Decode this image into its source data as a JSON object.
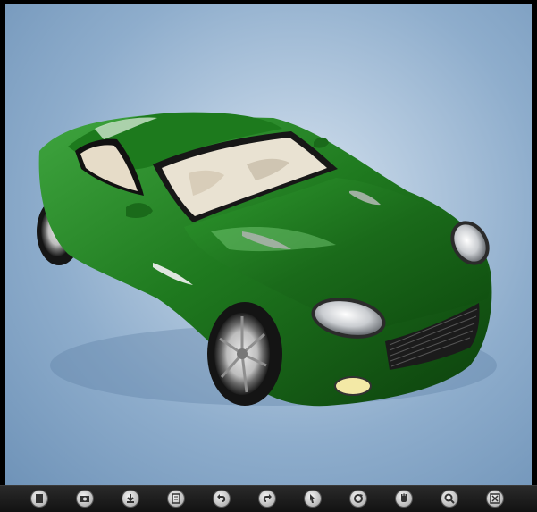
{
  "viewer": {
    "background_top": "#d7e3ef",
    "background_edge": "#6f93b8",
    "model_color": "#1f7a1f"
  },
  "toolbar": {
    "tools": [
      {
        "icon": "document-icon"
      },
      {
        "icon": "open-icon"
      },
      {
        "icon": "download-icon"
      },
      {
        "icon": "print-icon"
      },
      {
        "icon": "undo-icon"
      },
      {
        "icon": "redo-icon"
      },
      {
        "icon": "select-cursor-icon"
      },
      {
        "icon": "rotate-icon"
      },
      {
        "icon": "pan-hand-icon"
      },
      {
        "icon": "zoom-icon"
      },
      {
        "icon": "fit-view-icon"
      }
    ]
  }
}
